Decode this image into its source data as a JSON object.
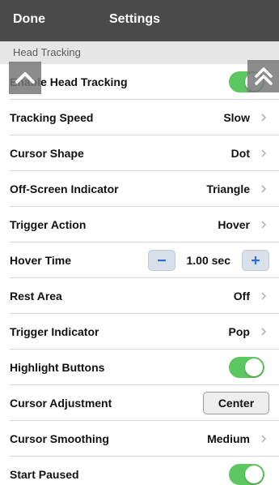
{
  "navbar": {
    "done_label": "Done",
    "title": "Settings"
  },
  "section": {
    "header": "Head Tracking"
  },
  "rows": [
    {
      "label": "Enable Head Tracking",
      "control": "toggle",
      "on": true
    },
    {
      "label": "Tracking Speed",
      "value": "Slow",
      "control": "disclosure"
    },
    {
      "label": "Cursor Shape",
      "value": "Dot",
      "control": "disclosure"
    },
    {
      "label": "Off-Screen Indicator",
      "value": "Triangle",
      "control": "disclosure"
    },
    {
      "label": "Trigger Action",
      "value": "Hover",
      "control": "disclosure"
    },
    {
      "label": "Hover Time",
      "value": "1.00 sec",
      "control": "stepper"
    },
    {
      "label": "Rest Area",
      "value": "Off",
      "control": "disclosure"
    },
    {
      "label": "Trigger Indicator",
      "value": "Pop",
      "control": "disclosure"
    },
    {
      "label": "Highlight Buttons",
      "control": "toggle",
      "on": true
    },
    {
      "label": "Cursor Adjustment",
      "button_label": "Center",
      "control": "button"
    },
    {
      "label": "Cursor Smoothing",
      "value": "Medium",
      "control": "disclosure"
    },
    {
      "label": "Start Paused",
      "control": "toggle",
      "on": true
    }
  ],
  "colors": {
    "navbar": "#4a4a4a",
    "toggle_on": "#5cc660",
    "stepper_icon": "#2f6fd6",
    "section_bg": "#e6e6e6"
  },
  "icons": {
    "scroll_up": "chevron-up-icon",
    "scroll_top": "double-chevron-up-icon",
    "disclosure": "chevron-right-icon",
    "minus": "minus-icon",
    "plus": "plus-icon"
  }
}
